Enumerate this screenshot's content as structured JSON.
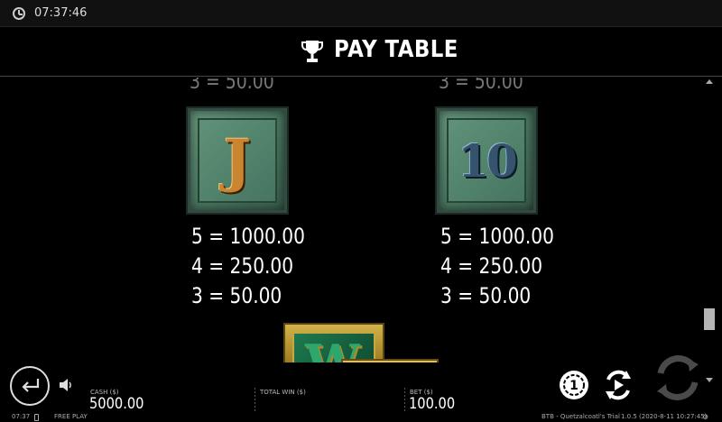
{
  "status": {
    "time": "07:37:46"
  },
  "header": {
    "title": "PAY TABLE",
    "icon": "trophy-icon"
  },
  "paytable": {
    "left": {
      "faded_prev": "3 = 50.00",
      "symbol": "J",
      "pays": [
        "5 = 1000.00",
        "4 = 250.00",
        "3 = 50.00"
      ]
    },
    "right": {
      "faded_prev": "3 = 50.00",
      "symbol": "10",
      "pays": [
        "5 = 1000.00",
        "4 = 250.00",
        "3 = 50.00"
      ]
    },
    "next_symbol": "W"
  },
  "bottom": {
    "cash_label": "CASH ($)",
    "cash_value": "5000.00",
    "total_win_label": "TOTAL WIN ($)",
    "bet_label": "BET ($)",
    "bet_value": "100.00"
  },
  "footer": {
    "time": "07:37",
    "mode": "FREE PLAY",
    "game": "BTB - Quetzalcoatl's Trial",
    "version": "1.0.5 (2020-8-11 10:27:45)"
  },
  "colors": {
    "background": "#000000",
    "tile_green": "#4b7b63",
    "j_gold": "#c9852f",
    "ten_blue": "#35536c"
  }
}
